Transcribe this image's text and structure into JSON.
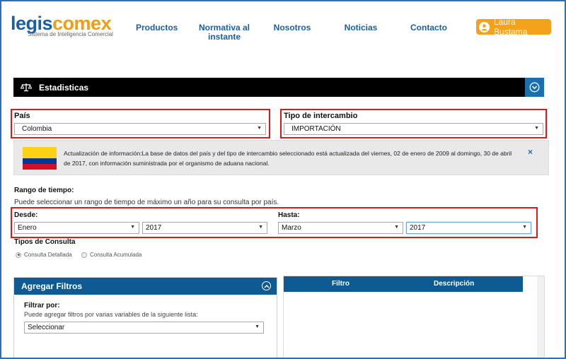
{
  "header": {
    "logo_main": "legis",
    "logo_accent": "comex",
    "logo_subtitle": "Sistema de Inteligencia Comercial",
    "nav": [
      {
        "label": "Productos"
      },
      {
        "label": "Normativa al instante"
      },
      {
        "label": "Nosotros"
      },
      {
        "label": "Noticias"
      },
      {
        "label": "Contacto"
      }
    ],
    "user_name": "Laura Bustama"
  },
  "stats_bar": {
    "title": "Estadisticas"
  },
  "country": {
    "label": "País",
    "value": "Colombia"
  },
  "exchange_type": {
    "label": "Tipo de intercambio",
    "value": "IMPORTACIÓN"
  },
  "info": {
    "text": "Actualización de información:La base de datos del país y del tipo de intercambio seleccionado está actualizada del viernes, 02 de enero de 2009 al domingo, 30 de abril de 2017, con información suministrada por el organismo de aduana nacional.",
    "close": "×"
  },
  "time_range": {
    "title": "Rango de tiempo:",
    "hint": "Puede seleccionar un rango de tiempo de máximo un año para su consulta por país.",
    "from_label": "Desde:",
    "from_month": "Enero",
    "from_year": "2017",
    "to_label": "Hasta:",
    "to_month": "Marzo",
    "to_year": "2017"
  },
  "query_types": {
    "title": "Tipos de Consulta",
    "options": [
      {
        "label": "Consulta Detallada",
        "selected": true
      },
      {
        "label": "Consulta Acumulada",
        "selected": false
      }
    ]
  },
  "filters": {
    "title": "Agregar Filtros",
    "filter_by": "Filtrar por:",
    "hint": "Puede agregar filtros por varias variables de la siguiente lista:",
    "select_value": "Seleccionar"
  },
  "filter_table": {
    "col_filter": "Filtro",
    "col_description": "Descripción"
  },
  "colors": {
    "brand_blue": "#1b5ea8",
    "brand_orange": "#f39c12",
    "highlight_red": "#e01818",
    "panel_blue": "#0e5a93"
  }
}
